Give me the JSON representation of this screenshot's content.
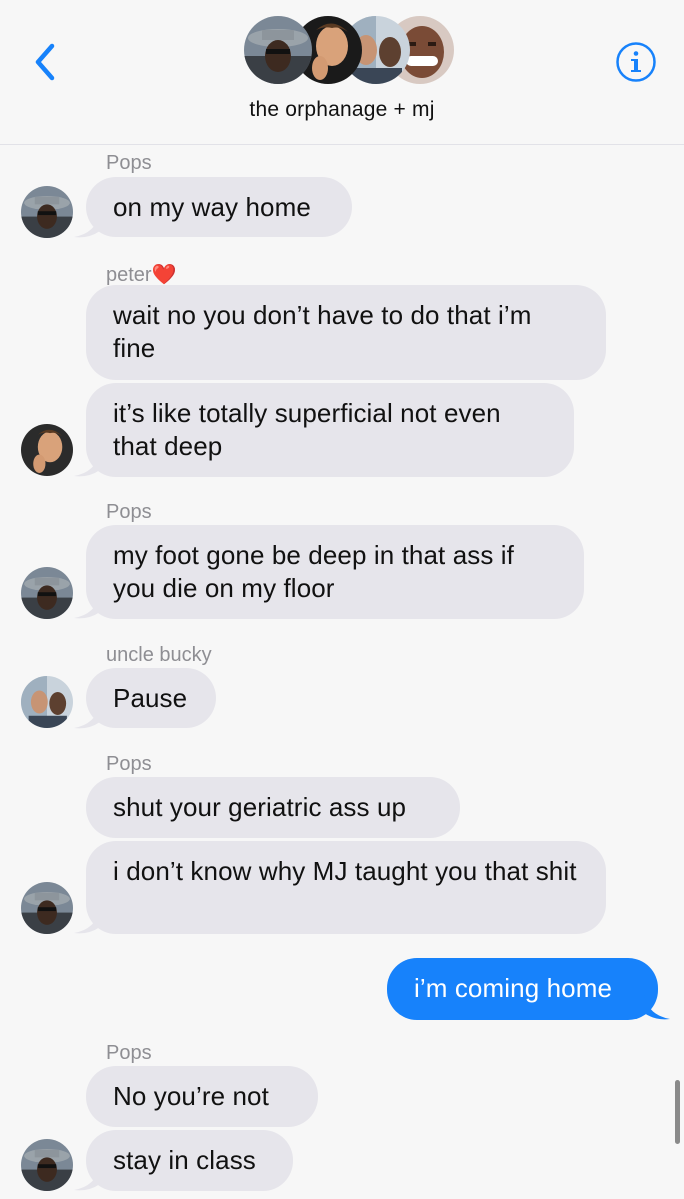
{
  "header": {
    "group_name": "the orphanage + mj",
    "back_icon": "chevron-left-icon",
    "info_icon": "info-icon",
    "accent_color": "#1782fb"
  },
  "messages": {
    "s1": "Pops",
    "m1": "on my way home",
    "s2": "peter",
    "s2_emoji": "❤️",
    "m2": "wait no you don’t have to do that i’m fine",
    "m3": "it’s like totally superficial not even that deep",
    "s3": "Pops",
    "m4": "my foot gone be deep in that ass if you die on my floor",
    "s4": "uncle bucky",
    "m5": "Pause",
    "s5": "Pops",
    "m6": "shut your geriatric ass up",
    "m7": "i don’t know why MJ taught you that shit",
    "m8": "i’m coming home",
    "s6": "Pops",
    "m9": "No you’re not",
    "m10": "stay in class"
  },
  "colors": {
    "incoming_bubble": "#e6e5eb",
    "outgoing_bubble": "#1782fb",
    "sender_label": "#8e8e93"
  }
}
